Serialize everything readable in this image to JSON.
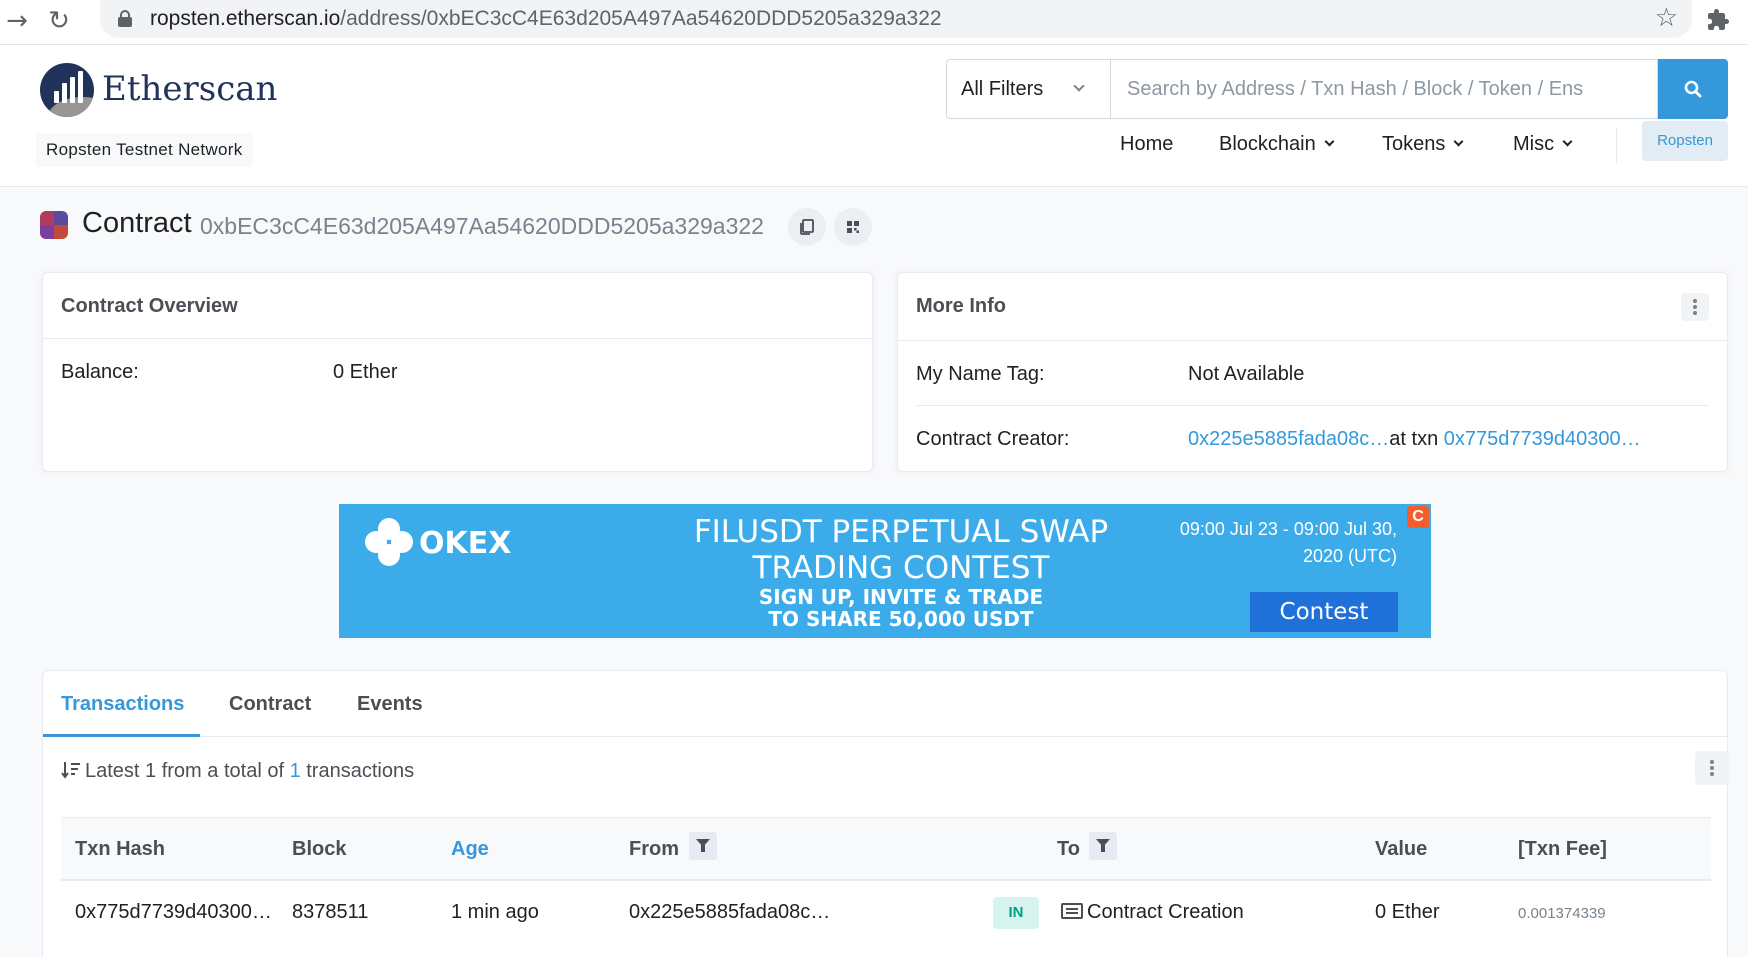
{
  "browser": {
    "url_host": "ropsten.etherscan.io",
    "url_path": "/address/0xbEC3cC4E63d205A497Aa54620DDD5205a329a322"
  },
  "header": {
    "logo_text": "Etherscan",
    "network_badge": "Ropsten Testnet Network",
    "filter_label": "All Filters",
    "search_placeholder": "Search by Address / Txn Hash / Block / Token / Ens",
    "nav": {
      "home": "Home",
      "blockchain": "Blockchain",
      "tokens": "Tokens",
      "misc": "Misc",
      "network": "Ropsten"
    }
  },
  "page": {
    "title_label": "Contract",
    "address": "0xbEC3cC4E63d205A497Aa54620DDD5205a329a322"
  },
  "overview": {
    "title": "Contract Overview",
    "balance_label": "Balance:",
    "balance_value": "0 Ether"
  },
  "more_info": {
    "title": "More Info",
    "name_tag_label": "My Name Tag:",
    "name_tag_value": "Not Available",
    "creator_label": "Contract Creator:",
    "creator_address": "0x225e5885fada08c…",
    "creator_at_txn": "at txn",
    "creator_txn": "0x775d7739d40300…"
  },
  "banner": {
    "brand": "OKEX",
    "headline_1": "FILUSDT PERPETUAL SWAP",
    "headline_2": "TRADING CONTEST",
    "sub_1": "SIGN UP, INVITE & TRADE",
    "sub_2": "TO SHARE 50,000 USDT",
    "date_1": "09:00 Jul 23 - 09:00 Jul 30,",
    "date_2": "2020 (UTC)",
    "cta": "Contest",
    "badge": "C",
    "color": "#3cabe9"
  },
  "tabs": {
    "transactions": "Transactions",
    "contract": "Contract",
    "events": "Events"
  },
  "summary": {
    "prefix": "Latest 1 from a total of",
    "count": "1",
    "suffix": "transactions"
  },
  "table": {
    "headers": {
      "txn_hash": "Txn Hash",
      "block": "Block",
      "age": "Age",
      "from": "From",
      "to": "To",
      "value": "Value",
      "fee": "[Txn Fee]"
    },
    "rows": [
      {
        "txn_hash": "0x775d7739d40300…",
        "block": "8378511",
        "age": "1 min ago",
        "from": "0x225e5885fada08c…",
        "direction": "IN",
        "to": "Contract Creation",
        "value": "0 Ether",
        "fee": "0.001374339"
      }
    ]
  },
  "colors": {
    "accent": "#3498db",
    "brand_navy": "#21325b",
    "in_badge_bg": "#d4f4ed",
    "in_badge_text": "#00a186"
  }
}
